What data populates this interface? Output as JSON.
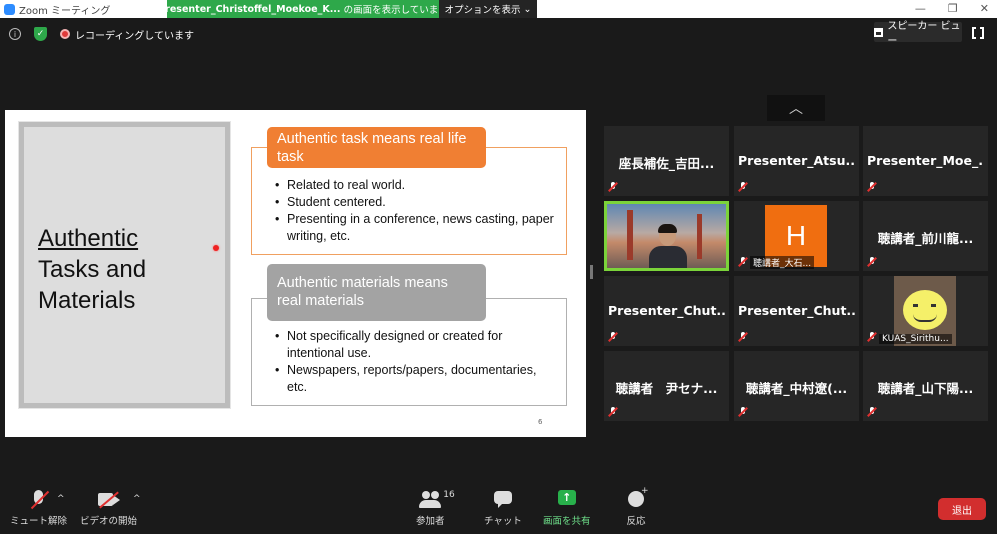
{
  "window": {
    "title": "Zoom ミーティング",
    "share_banner_presenter": "Presenter_Christoffel_Moekoe_K...",
    "share_banner_suffix": "の画面を表示しています",
    "options_label": "オプションを表示",
    "minimize": "—",
    "restore": "❐",
    "close": "✕"
  },
  "topbar": {
    "recording_text": "レコーディングしています",
    "speaker_view_label": "スピーカー ビュー"
  },
  "slide": {
    "title_line1": "Authentic",
    "title_line2": "Tasks and",
    "title_line3": "Materials",
    "box1_heading": "Authentic task means real life task",
    "box1_bullets": [
      "Related to real world.",
      "Student centered.",
      "Presenting in a conference, news casting, paper writing, etc."
    ],
    "box2_heading": "Authentic materials means real materials",
    "box2_bullets": [
      "Not specifically designed or created for intentional use.",
      "Newspapers, reports/papers, documentaries, etc."
    ],
    "page_number": "6"
  },
  "gallery": {
    "scroll_up": "︿",
    "tiles": [
      {
        "name": "座長補佐_吉田..."
      },
      {
        "name": "Presenter_Atsu..."
      },
      {
        "name": "Presenter_Moe_..."
      },
      {
        "name": ""
      },
      {
        "name": "聴講者_大石...",
        "avatar_letter": "H"
      },
      {
        "name": "聴講者_前川龍..."
      },
      {
        "name": "Presenter_Chut..."
      },
      {
        "name": "Presenter_Chut..."
      },
      {
        "name": "KUAS_Sirithu..."
      },
      {
        "name": "聴講者　尹セナ..."
      },
      {
        "name": "聴講者_中村遼(..."
      },
      {
        "name": "聴講者_山下陽..."
      }
    ]
  },
  "toolbar": {
    "unmute_label": "ミュート解除",
    "start_video_label": "ビデオの開始",
    "participants_label": "参加者",
    "participants_count": "16",
    "chat_label": "チャット",
    "share_label": "画面を共有",
    "reactions_label": "反応",
    "leave_label": "退出",
    "caret": "^"
  },
  "colors": {
    "share_green": "#2ea84a",
    "orange_heading": "#f07f33",
    "gray_heading": "#a3a3a3",
    "leave_red": "#d22e2e",
    "active_speaker_border": "#7bd33a"
  }
}
